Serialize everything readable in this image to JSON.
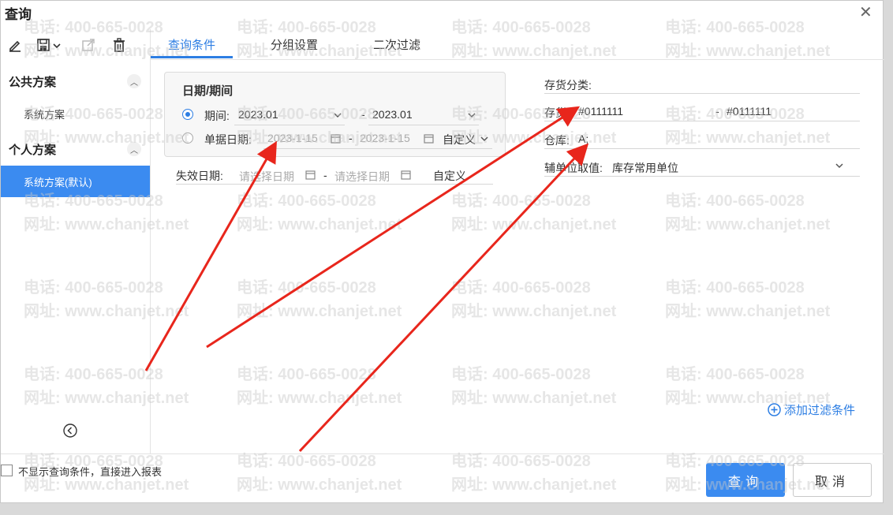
{
  "dialog": {
    "title": "查询",
    "close_glyph": "✕"
  },
  "toolbar": {
    "icons": [
      "pencil-icon",
      "save-icon",
      "export-icon",
      "trash-icon"
    ]
  },
  "left_panel": {
    "public_title": "公共方案",
    "public_items": [
      "系统方案"
    ],
    "personal_title": "个人方案",
    "personal_items": [
      "系统方案(默认)"
    ]
  },
  "tabs": [
    {
      "label": "查询条件",
      "active": true
    },
    {
      "label": "分组设置",
      "active": false
    },
    {
      "label": "二次过滤",
      "active": false
    }
  ],
  "date_section": {
    "title": "日期/期间",
    "period": {
      "label": "期间:",
      "from": "2023.01",
      "separator": "-",
      "to": "2023.01",
      "selected": true
    },
    "doc_date": {
      "label": "单据日期:",
      "from": "2023-1-15",
      "separator": "-",
      "to": "2023-1-15",
      "mode": "自定义",
      "selected": false
    }
  },
  "expiry": {
    "label": "失效日期:",
    "from_placeholder": "请选择日期",
    "separator": "-",
    "to_placeholder": "请选择日期",
    "mode": "自定义"
  },
  "right_fields": {
    "inventory_category": {
      "label": "存货分类:",
      "value": ""
    },
    "inventory": {
      "label": "存货:",
      "from": "#0111111",
      "separator": "-",
      "to": "#0111111"
    },
    "warehouse": {
      "label": "仓库:",
      "value": "A;"
    },
    "aux_unit": {
      "label": "辅单位取值:",
      "value": "库存常用单位"
    }
  },
  "add_filter_label": "添加过滤条件",
  "footer": {
    "skip_label": "不显示查询条件，直接进入报表",
    "query_button": "查询",
    "cancel_button": "取消"
  },
  "watermark": {
    "phone": "电话: 400-665-0028",
    "site": "网址: www.chanjet.net"
  },
  "colors": {
    "accent": "#2d7ee3",
    "button_primary": "#3b8bf0",
    "arrow": "#e8261c"
  }
}
